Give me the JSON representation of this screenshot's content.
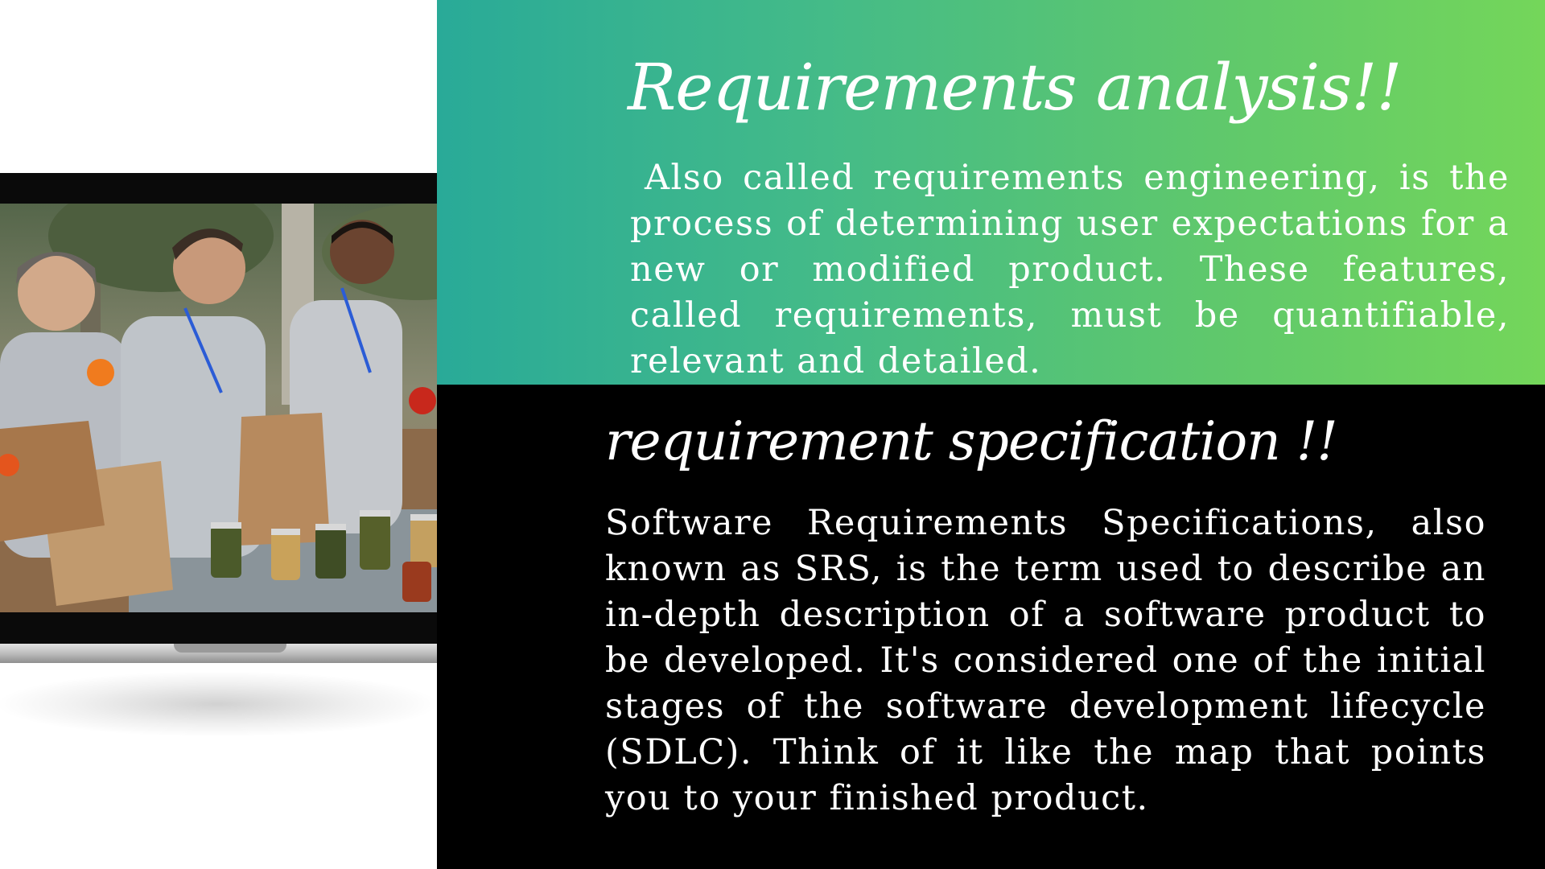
{
  "slide": {
    "sections": [
      {
        "title": "Requirements analysis!!",
        "body": "Also called requirements engineering, is the process of determining user expectations for a new or modified product. These features, called requirements, must be quantifiable, relevant and detailed."
      },
      {
        "title": "requirement specification !!",
        "body": "Software Requirements Specifications, also known as SRS, is the term used to describe an in-depth description of a software product to be developed. It's considered one of the initial stages of the software development lifecycle (SDLC). Think of it like the map that points you to your finished product."
      }
    ],
    "colors": {
      "gradient_start": "#29aa98",
      "gradient_end": "#74d65a",
      "dark_panel": "#000000",
      "text": "#ffffff"
    },
    "image": {
      "device": "laptop-icon"
    }
  }
}
